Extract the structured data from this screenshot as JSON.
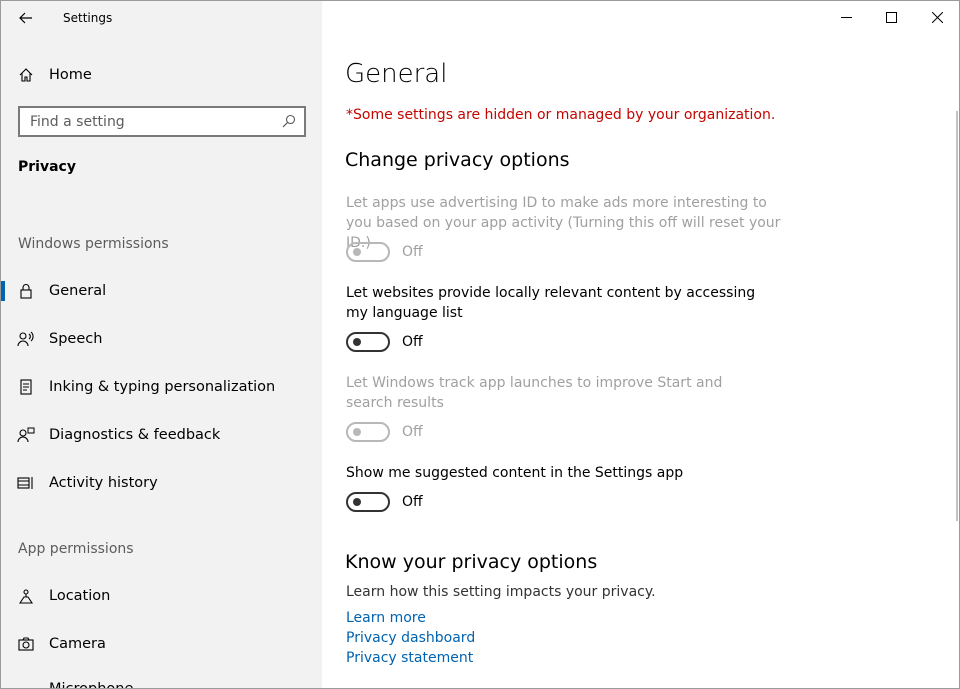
{
  "window": {
    "title": "Settings",
    "back_icon": "arrow-left-icon",
    "minimize_icon": "minimize-icon",
    "maximize_icon": "maximize-icon",
    "close_icon": "close-icon"
  },
  "sidebar": {
    "home": {
      "label": "Home",
      "icon": "home-icon"
    },
    "search": {
      "placeholder": "Find a setting",
      "icon": "search-icon"
    },
    "category": "Privacy",
    "windows_permissions_label": "Windows permissions",
    "windows_permissions": [
      {
        "label": "General",
        "icon": "lock-icon",
        "selected": true
      },
      {
        "label": "Speech",
        "icon": "speech-icon",
        "selected": false
      },
      {
        "label": "Inking & typing personalization",
        "icon": "inking-icon",
        "selected": false
      },
      {
        "label": "Diagnostics & feedback",
        "icon": "diagnostics-icon",
        "selected": false
      },
      {
        "label": "Activity history",
        "icon": "activity-history-icon",
        "selected": false
      }
    ],
    "app_permissions_label": "App permissions",
    "app_permissions": [
      {
        "label": "Location",
        "icon": "location-icon"
      },
      {
        "label": "Camera",
        "icon": "camera-icon"
      },
      {
        "label": "Microphone",
        "icon": "microphone-icon"
      }
    ]
  },
  "main": {
    "title": "General",
    "managed_notice": "*Some settings are hidden or managed by your organization.",
    "change_heading": "Change privacy options",
    "options": [
      {
        "text": "Let apps use advertising ID to make ads more interesting to you based on your app activity (Turning this off will reset your ID.)",
        "state": "Off",
        "enabled": false
      },
      {
        "text": "Let websites provide locally relevant content by accessing my language list",
        "state": "Off",
        "enabled": true
      },
      {
        "text": "Let Windows track app launches to improve Start and search results",
        "state": "Off",
        "enabled": false
      },
      {
        "text": "Show me suggested content in the Settings app",
        "state": "Off",
        "enabled": true
      }
    ],
    "know_heading": "Know your privacy options",
    "know_desc": "Learn how this setting impacts your privacy.",
    "links": [
      "Learn more",
      "Privacy dashboard",
      "Privacy statement"
    ]
  },
  "colors": {
    "accent": "#0063b1",
    "warning": "#c50500",
    "sidebar_bg": "#f2f2f2"
  }
}
